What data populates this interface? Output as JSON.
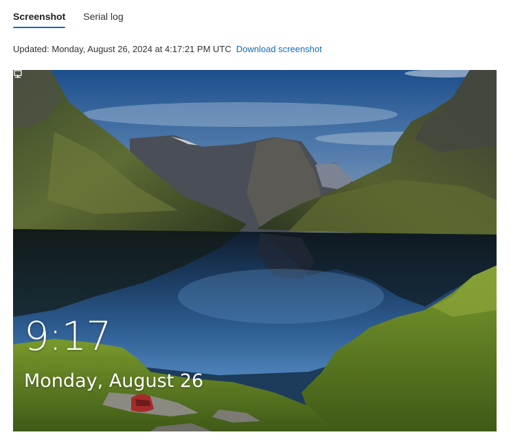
{
  "tabs": [
    {
      "label": "Screenshot",
      "active": true
    },
    {
      "label": "Serial log",
      "active": false
    }
  ],
  "status": {
    "updated_text": "Updated: Monday, August 26, 2024 at 4:17:21 PM UTC",
    "download_label": "Download screenshot"
  },
  "lock_screen": {
    "time": "9:17",
    "date": "Monday, August 26",
    "tray_icon": "network-icon"
  },
  "colors": {
    "accent": "#0f6cbd",
    "text": "#323130"
  }
}
